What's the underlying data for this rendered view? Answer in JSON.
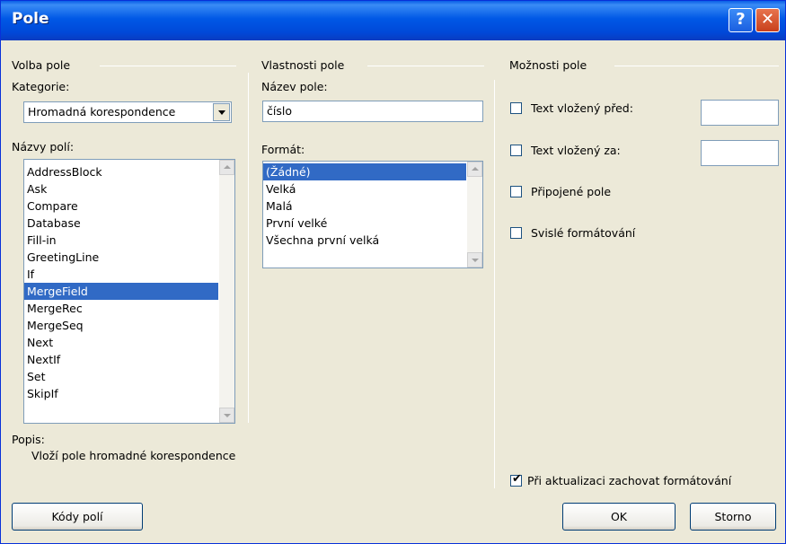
{
  "window": {
    "title": "Pole",
    "help_glyph": "?",
    "close_glyph": "✕"
  },
  "volba": {
    "group_label": "Volba pole",
    "category_label": "Kategorie:",
    "category_value": "Hromadná korespondence",
    "names_label": "Názvy polí:",
    "names": [
      "AddressBlock",
      "Ask",
      "Compare",
      "Database",
      "Fill-in",
      "GreetingLine",
      "If",
      "MergeField",
      "MergeRec",
      "MergeSeq",
      "Next",
      "NextIf",
      "Set",
      "SkipIf"
    ],
    "selected_name": "MergeField"
  },
  "vlastnosti": {
    "group_label": "Vlastnosti pole",
    "name_label": "Název pole:",
    "name_value": "číslo",
    "format_label": "Formát:",
    "formats": [
      "(Žádné)",
      "Velká",
      "Malá",
      "První velké",
      "Všechna první velká"
    ],
    "selected_format": "(Žádné)"
  },
  "moznosti": {
    "group_label": "Možnosti pole",
    "text_before_label": "Text vložený před:",
    "text_before_value": "",
    "text_after_label": "Text vložený za:",
    "text_after_value": "",
    "mapped_label": "Připojené pole",
    "vertical_label": "Svislé formátování",
    "preserve_label": "Při aktualizaci zachovat formátování",
    "preserve_checked": true
  },
  "popis": {
    "label": "Popis:",
    "text": "Vloží pole hromadné korespondence"
  },
  "buttons": {
    "codes": "Kódy polí",
    "ok": "OK",
    "cancel": "Storno"
  }
}
